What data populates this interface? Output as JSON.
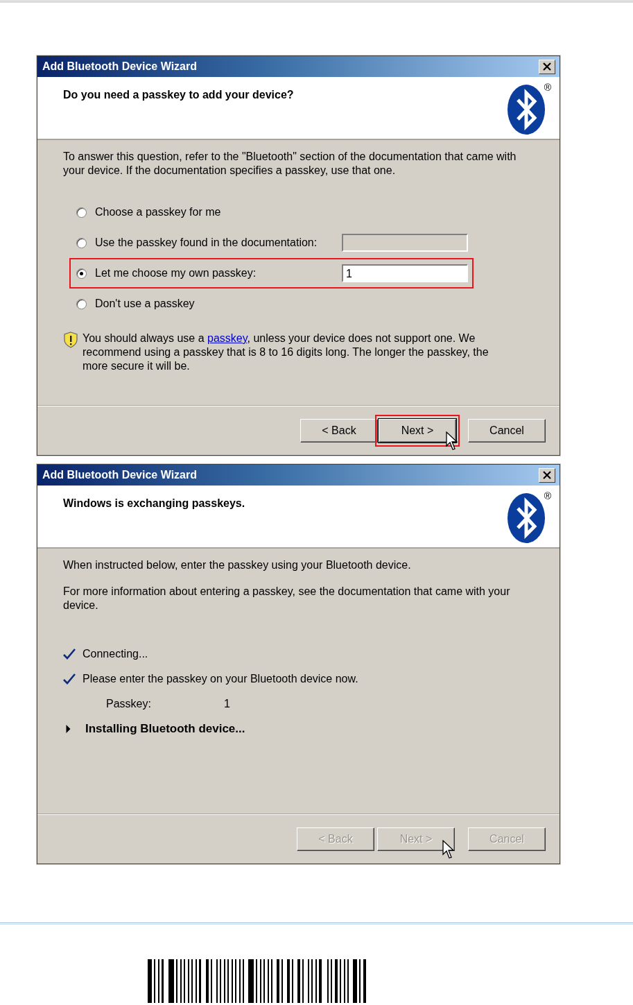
{
  "dialogs": [
    {
      "kind": "passkey_choice",
      "title": "Add Bluetooth Device Wizard",
      "heading": "Do you need a passkey to add your device?",
      "logo_mark": "®",
      "paragraphs": [
        "To answer this question, refer to the \"Bluetooth\" section of the documentation that came with your device. If the documentation specifies a passkey, use that one."
      ],
      "options": [
        {
          "label": "Choose a passkey for me",
          "selected": false,
          "has_field": false,
          "callout": false
        },
        {
          "label": "Use the passkey found in the documentation:",
          "selected": false,
          "has_field": true,
          "callout": false
        },
        {
          "label": "Let me choose my own passkey:",
          "selected": true,
          "has_field": true,
          "value": "1",
          "callout": true
        },
        {
          "label": "Don't use a passkey",
          "selected": false,
          "has_field": false,
          "callout": false
        }
      ],
      "note": {
        "before": "You should always use a ",
        "link": "passkey",
        "after": ", unless your device does not support one. We recommend using a passkey that is 8 to 16 digits long. The longer the passkey, the more secure it will be."
      },
      "buttons": [
        {
          "label": "< Back",
          "disabled": false,
          "callout": false,
          "cursor": false
        },
        {
          "label": "Next >",
          "disabled": false,
          "callout": true,
          "cursor": true
        },
        {
          "label": "Cancel",
          "disabled": false,
          "callout": false,
          "cursor": false
        }
      ]
    },
    {
      "kind": "progress",
      "title": "Add Bluetooth Device Wizard",
      "heading": "Windows is exchanging passkeys.",
      "logo_mark": "®",
      "paragraphs": [
        "When instructed below, enter the passkey using your Bluetooth device.",
        "For more information about entering a passkey, see the documentation that came with your device."
      ],
      "steps": [
        {
          "kind": "done",
          "text": "Connecting..."
        },
        {
          "kind": "done",
          "text": "Please enter the passkey on your Bluetooth device now."
        },
        {
          "kind": "passkey",
          "label": "Passkey:",
          "value": "1"
        },
        {
          "kind": "active",
          "text": "Installing Bluetooth device..."
        }
      ],
      "buttons": [
        {
          "label": "< Back",
          "disabled": true,
          "callout": false,
          "cursor": false
        },
        {
          "label": "Next >",
          "disabled": true,
          "callout": false,
          "cursor": true
        },
        {
          "label": "Cancel",
          "disabled": true,
          "callout": false,
          "cursor": false
        }
      ]
    }
  ]
}
